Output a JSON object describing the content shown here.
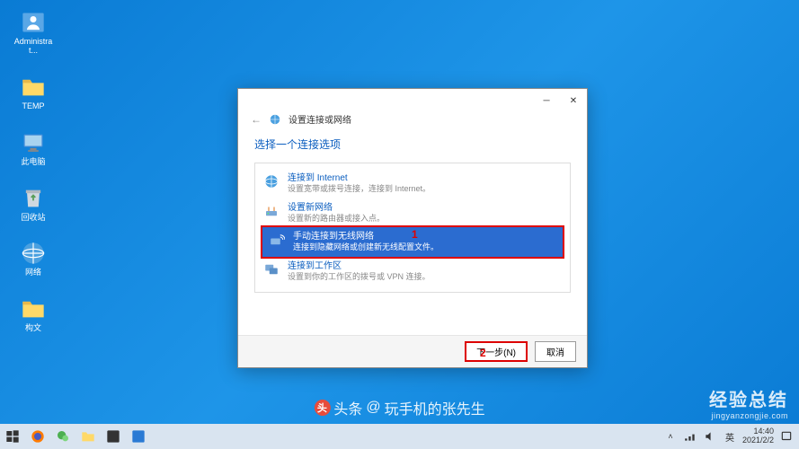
{
  "desktop": {
    "icons": [
      {
        "label": "Administrat...",
        "type": "user"
      },
      {
        "label": "TEMP",
        "type": "folder"
      },
      {
        "label": "此电脑",
        "type": "pc"
      },
      {
        "label": "回收站",
        "type": "recycle"
      },
      {
        "label": "网络",
        "type": "network"
      },
      {
        "label": "构文",
        "type": "folder"
      }
    ]
  },
  "dialog": {
    "title": "设置连接或网络",
    "heading": "选择一个连接选项",
    "options": [
      {
        "title": "连接到 Internet",
        "desc": "设置宽带或拨号连接，连接到 Internet。",
        "icon": "globe",
        "selected": false
      },
      {
        "title": "设置新网络",
        "desc": "设置新的路由器或接入点。",
        "icon": "router",
        "selected": false
      },
      {
        "title": "手动连接到无线网络",
        "desc": "连接到隐藏网络或创建新无线配置文件。",
        "icon": "wireless",
        "selected": true
      },
      {
        "title": "连接到工作区",
        "desc": "设置到你的工作区的拨号或 VPN 连接。",
        "icon": "workplace",
        "selected": false
      }
    ],
    "annotations": {
      "a1": "1",
      "a2": "2"
    },
    "buttons": {
      "next": "下一步(N)",
      "cancel": "取消"
    }
  },
  "taskbar": {
    "time": "14:40",
    "date": "2021/2/2",
    "ime": "英"
  },
  "watermarks": {
    "w1_prefix": "头条",
    "w1_at": "@",
    "w1_name": "玩手机的张先生",
    "w2_main": "经验总结",
    "w2_url": "jingyanzongjie.com"
  }
}
